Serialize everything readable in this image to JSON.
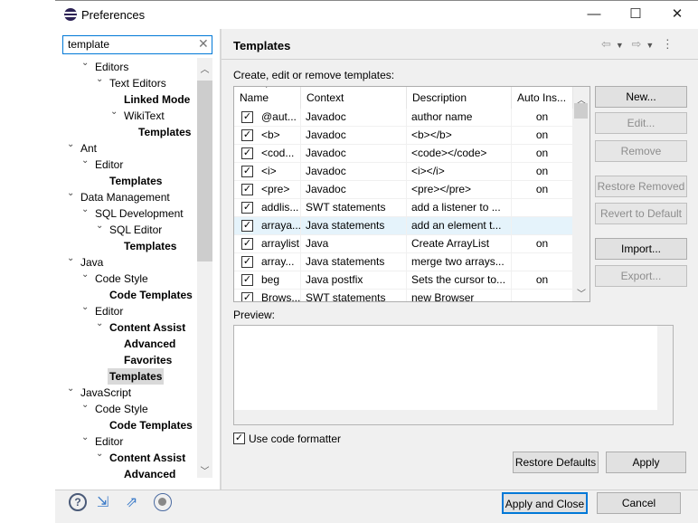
{
  "window": {
    "title": "Preferences",
    "minimize": "—",
    "maximize": "☐",
    "close": "✕"
  },
  "search": {
    "value": "template"
  },
  "tree": [
    {
      "label": "Editors",
      "depth": 1,
      "expanded": true,
      "bold": false
    },
    {
      "label": "Text Editors",
      "depth": 2,
      "expanded": true,
      "bold": false
    },
    {
      "label": "Linked Mode",
      "depth": 3,
      "bold": true
    },
    {
      "label": "WikiText",
      "depth": 3,
      "expanded": true,
      "bold": false
    },
    {
      "label": "Templates",
      "depth": 4,
      "bold": true
    },
    {
      "label": "Ant",
      "depth": 0,
      "expanded": true,
      "bold": false
    },
    {
      "label": "Editor",
      "depth": 1,
      "expanded": true,
      "bold": false
    },
    {
      "label": "Templates",
      "depth": 2,
      "bold": true
    },
    {
      "label": "Data Management",
      "depth": 0,
      "expanded": true,
      "bold": false
    },
    {
      "label": "SQL Development",
      "depth": 1,
      "expanded": true,
      "bold": false
    },
    {
      "label": "SQL Editor",
      "depth": 2,
      "expanded": true,
      "bold": false
    },
    {
      "label": "Templates",
      "depth": 3,
      "bold": true
    },
    {
      "label": "Java",
      "depth": 0,
      "expanded": true,
      "bold": false
    },
    {
      "label": "Code Style",
      "depth": 1,
      "expanded": true,
      "bold": false
    },
    {
      "label": "Code Templates",
      "depth": 2,
      "bold": true
    },
    {
      "label": "Editor",
      "depth": 1,
      "expanded": true,
      "bold": false
    },
    {
      "label": "Content Assist",
      "depth": 2,
      "expanded": true,
      "bold": true
    },
    {
      "label": "Advanced",
      "depth": 3,
      "bold": true
    },
    {
      "label": "Favorites",
      "depth": 3,
      "bold": true
    },
    {
      "label": "Templates",
      "depth": 2,
      "bold": true,
      "selected": true
    },
    {
      "label": "JavaScript",
      "depth": 0,
      "expanded": true,
      "bold": false
    },
    {
      "label": "Code Style",
      "depth": 1,
      "expanded": true,
      "bold": false
    },
    {
      "label": "Code Templates",
      "depth": 2,
      "bold": true
    },
    {
      "label": "Editor",
      "depth": 1,
      "expanded": true,
      "bold": false
    },
    {
      "label": "Content Assist",
      "depth": 2,
      "expanded": true,
      "bold": true
    },
    {
      "label": "Advanced",
      "depth": 3,
      "bold": true
    }
  ],
  "page": {
    "title": "Templates",
    "intro": "Create, edit or remove templates:",
    "preview_label": "Preview:",
    "use_formatter": "Use code formatter"
  },
  "table": {
    "columns": [
      "Name",
      "Context",
      "Description",
      "Auto Ins..."
    ],
    "rows": [
      {
        "checked": true,
        "name": "@aut...",
        "context": "Javadoc",
        "description": "author name",
        "auto": "on"
      },
      {
        "checked": true,
        "name": "<b>",
        "context": "Javadoc",
        "description": "<b></b>",
        "auto": "on"
      },
      {
        "checked": true,
        "name": "<cod...",
        "context": "Javadoc",
        "description": "<code></code>",
        "auto": "on"
      },
      {
        "checked": true,
        "name": "<i>",
        "context": "Javadoc",
        "description": "<i></i>",
        "auto": "on"
      },
      {
        "checked": true,
        "name": "<pre>",
        "context": "Javadoc",
        "description": "<pre></pre>",
        "auto": "on"
      },
      {
        "checked": true,
        "name": "addlis...",
        "context": "SWT statements",
        "description": "add a listener to ...",
        "auto": ""
      },
      {
        "checked": true,
        "name": "arraya...",
        "context": "Java statements",
        "description": "add an element t...",
        "auto": "",
        "highlighted": true
      },
      {
        "checked": true,
        "name": "arraylist",
        "context": "Java",
        "description": "Create ArrayList",
        "auto": "on"
      },
      {
        "checked": true,
        "name": "array...",
        "context": "Java statements",
        "description": "merge two arrays...",
        "auto": ""
      },
      {
        "checked": true,
        "name": "beg",
        "context": "Java postfix",
        "description": "Sets the cursor to...",
        "auto": "on"
      },
      {
        "checked": true,
        "name": "Brows...",
        "context": "SWT statements",
        "description": "new Browser",
        "auto": ""
      }
    ]
  },
  "buttons": {
    "new": "New...",
    "edit": "Edit...",
    "remove": "Remove",
    "restore_removed": "Restore Removed",
    "revert": "Revert to Default",
    "import": "Import...",
    "export": "Export...",
    "restore_defaults": "Restore Defaults",
    "apply": "Apply",
    "apply_close": "Apply and Close",
    "cancel": "Cancel"
  }
}
